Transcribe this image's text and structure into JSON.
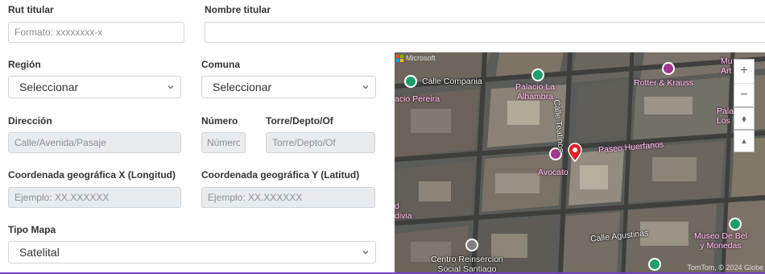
{
  "form": {
    "rut": {
      "label": "Rut titular",
      "placeholder": "Formato: xxxxxxxx-x"
    },
    "nombre": {
      "label": "Nombre titular",
      "placeholder": ""
    },
    "region": {
      "label": "Región",
      "selected": "Seleccionar"
    },
    "comuna": {
      "label": "Comuna",
      "selected": "Seleccionar"
    },
    "direccion": {
      "label": "Dirección",
      "placeholder": "Calle/Avenida/Pasaje"
    },
    "numero": {
      "label": "Número",
      "placeholder": "Número"
    },
    "torre": {
      "label": "Torre/Depto/Of",
      "placeholder": "Torre/Depto/Of"
    },
    "coord_x": {
      "label": "Coordenada geográfica X (Longitud)",
      "placeholder": "Ejemplo: XX.XXXXXX"
    },
    "coord_y": {
      "label": "Coordenada geográfica Y (Latitud)",
      "placeholder": "Ejemplo: XX.XXXXXX"
    },
    "tipo_mapa": {
      "label": "Tipo Mapa",
      "selected": "Satelital"
    }
  },
  "map": {
    "brand": "Microsoft",
    "labels": {
      "calle_compania": "Calle Compania",
      "palacio_alhambra": "Palacio La\nAlhambra",
      "calle_teatinos": "Calle Teatinos",
      "rotter_krauss": "Rotter & Krauss",
      "mu_art": "Mu\nArt",
      "palacio_los": "Pala\nLos",
      "cio_pereira": "acio Pereira",
      "paseo_huerfanos": "Paseo Huerfanos",
      "avocato": "Avocato",
      "d_divia": "d\ndivia",
      "calle_agustinas": "Calle Agustinas",
      "museo_bellas": "Museo De Bel\ny Monedas",
      "centro_reinsercion": "Centro Reinsercion\nSocial Santiago"
    },
    "attribution": "TomTom, © 2024 Globe",
    "controls": {
      "zoom_in": "+",
      "zoom_out": "−",
      "compass": "⬧",
      "tilt": "▲"
    },
    "colors": {
      "pin_red": "#e0202a",
      "poi_green": "#1e9e6a",
      "poi_purple": "#a2378c"
    }
  }
}
